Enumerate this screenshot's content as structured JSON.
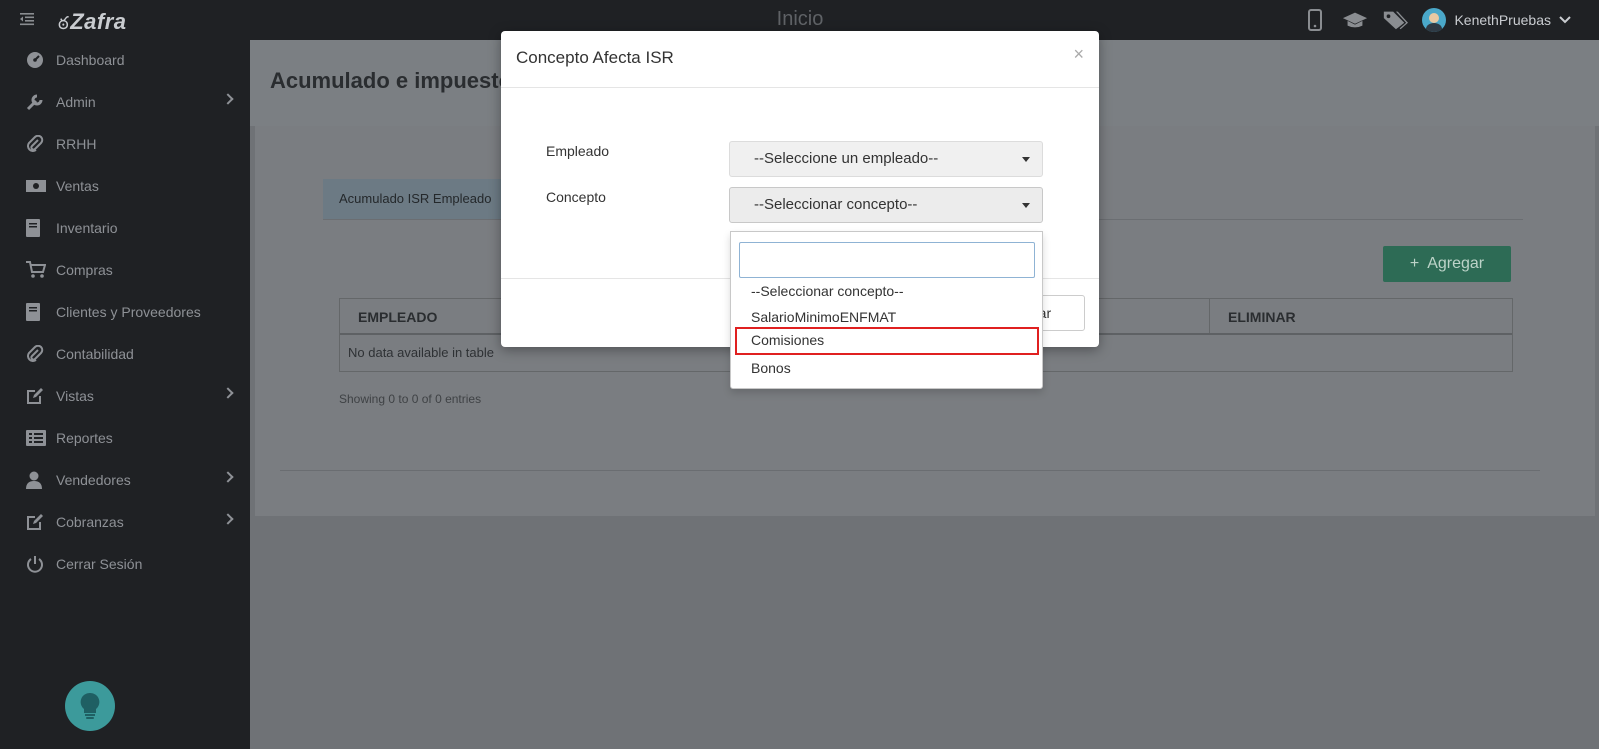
{
  "app": {
    "logo_text": "Zafra",
    "page_title_top": "Inicio",
    "user_name": "KenethPruebas"
  },
  "sidebar": {
    "items": [
      {
        "label": "Dashboard",
        "icon": "dashboard-icon",
        "has_submenu": false
      },
      {
        "label": "Admin",
        "icon": "wrench-icon",
        "has_submenu": true
      },
      {
        "label": "RRHH",
        "icon": "paperclip-icon",
        "has_submenu": false
      },
      {
        "label": "Ventas",
        "icon": "money-icon",
        "has_submenu": false
      },
      {
        "label": "Inventario",
        "icon": "book-icon",
        "has_submenu": false
      },
      {
        "label": "Compras",
        "icon": "cart-icon",
        "has_submenu": false
      },
      {
        "label": "Clientes y Proveedores",
        "icon": "book-icon",
        "has_submenu": false
      },
      {
        "label": "Contabilidad",
        "icon": "paperclip-icon",
        "has_submenu": false
      },
      {
        "label": "Vistas",
        "icon": "edit-icon",
        "has_submenu": true
      },
      {
        "label": "Reportes",
        "icon": "list-icon",
        "has_submenu": false
      },
      {
        "label": "Vendedores",
        "icon": "user-icon",
        "has_submenu": true
      },
      {
        "label": "Cobranzas",
        "icon": "edit-icon",
        "has_submenu": true
      },
      {
        "label": "Cerrar Sesión",
        "icon": "power-icon",
        "has_submenu": false
      }
    ]
  },
  "main": {
    "title": "Acumulado e impuesto",
    "tab_label": "Acumulado ISR Empleado",
    "add_button": "Agregar",
    "table": {
      "columns": [
        "EMPLEADO",
        "ELIMINAR"
      ],
      "empty_message": "No data available in table"
    },
    "showing_text": "Showing 0 to 0 of 0 entries"
  },
  "modal": {
    "title": "Concepto Afecta ISR",
    "close_symbol": "×",
    "empleado_label": "Empleado",
    "empleado_value": "--Seleccione un empleado--",
    "concepto_label": "Concepto",
    "concepto_value": "--Seleccionar concepto--",
    "save_button_partial": "rar"
  },
  "dropdown": {
    "search_value": "",
    "options": [
      "--Seleccionar concepto--",
      "SalarioMinimoENFMAT",
      "Comisiones",
      "Bonos"
    ],
    "highlighted": "Comisiones"
  },
  "colors": {
    "sidebar_bg": "#1f2124",
    "add_button_bg": "#2d6b55",
    "highlight_outline": "#e02020",
    "bulb_bg": "#3c9a9b"
  }
}
